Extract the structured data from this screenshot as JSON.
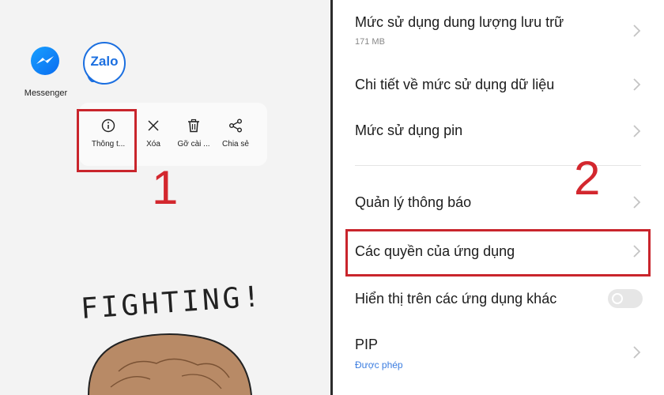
{
  "left": {
    "apps": [
      {
        "label": "Messenger",
        "icon": "messenger-icon"
      },
      {
        "label": "",
        "icon": "zalo-icon",
        "logo_text": "Zalo"
      }
    ],
    "context_menu": [
      {
        "label": "Thông t...",
        "icon": "info-icon"
      },
      {
        "label": "Xóa",
        "icon": "close-icon"
      },
      {
        "label": "Gỡ cài ...",
        "icon": "trash-icon"
      },
      {
        "label": "Chia sẻ",
        "icon": "share-icon"
      }
    ],
    "step": "1",
    "wallpaper_text": "FIGHTING!"
  },
  "right": {
    "rows": [
      {
        "title": "Mức sử dụng dung lượng lưu trữ",
        "subtitle": "171 MB"
      },
      {
        "title": "Chi tiết về mức sử dụng dữ liệu"
      },
      {
        "title": "Mức sử dụng pin"
      },
      {
        "title": "Quản lý thông báo"
      },
      {
        "title": "Các quyền của ứng dụng"
      },
      {
        "title": "Hiển thị trên các ứng dụng khác",
        "toggle": false
      },
      {
        "title": "PIP",
        "subtitle": "Được phép"
      }
    ],
    "step": "2"
  },
  "colors": {
    "highlight": "#c9252c",
    "step_number": "#d3272e",
    "subtitle_blue": "#3b7de0"
  }
}
